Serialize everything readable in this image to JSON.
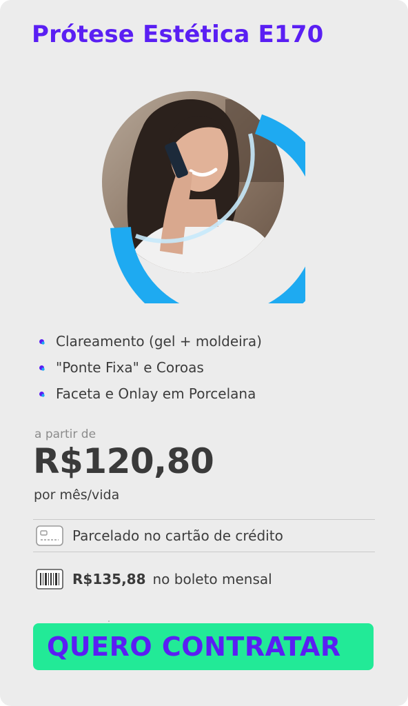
{
  "plan": {
    "title": "Prótese Estética E170"
  },
  "photo": {
    "icon": "person-on-phone-photo",
    "ring_color": "#1eaaf1"
  },
  "features": [
    "Clareamento (gel + moldeira)",
    "\"Ponte Fixa\" e Coroas",
    "Faceta e Onlay em Porcelana"
  ],
  "pricing": {
    "from_label": "a partir de",
    "price": "R$120,80",
    "period": "por mês/vida"
  },
  "payment": {
    "card_text": "Parcelado no cartão de crédito",
    "boleto_price": "R$135,88",
    "boleto_text": "no boleto mensal"
  },
  "cta": {
    "label": "QUERO CONTRATAR"
  },
  "colors": {
    "accent": "#5a1ff3",
    "cta_background": "#22ea97",
    "card_background": "#ececec"
  }
}
